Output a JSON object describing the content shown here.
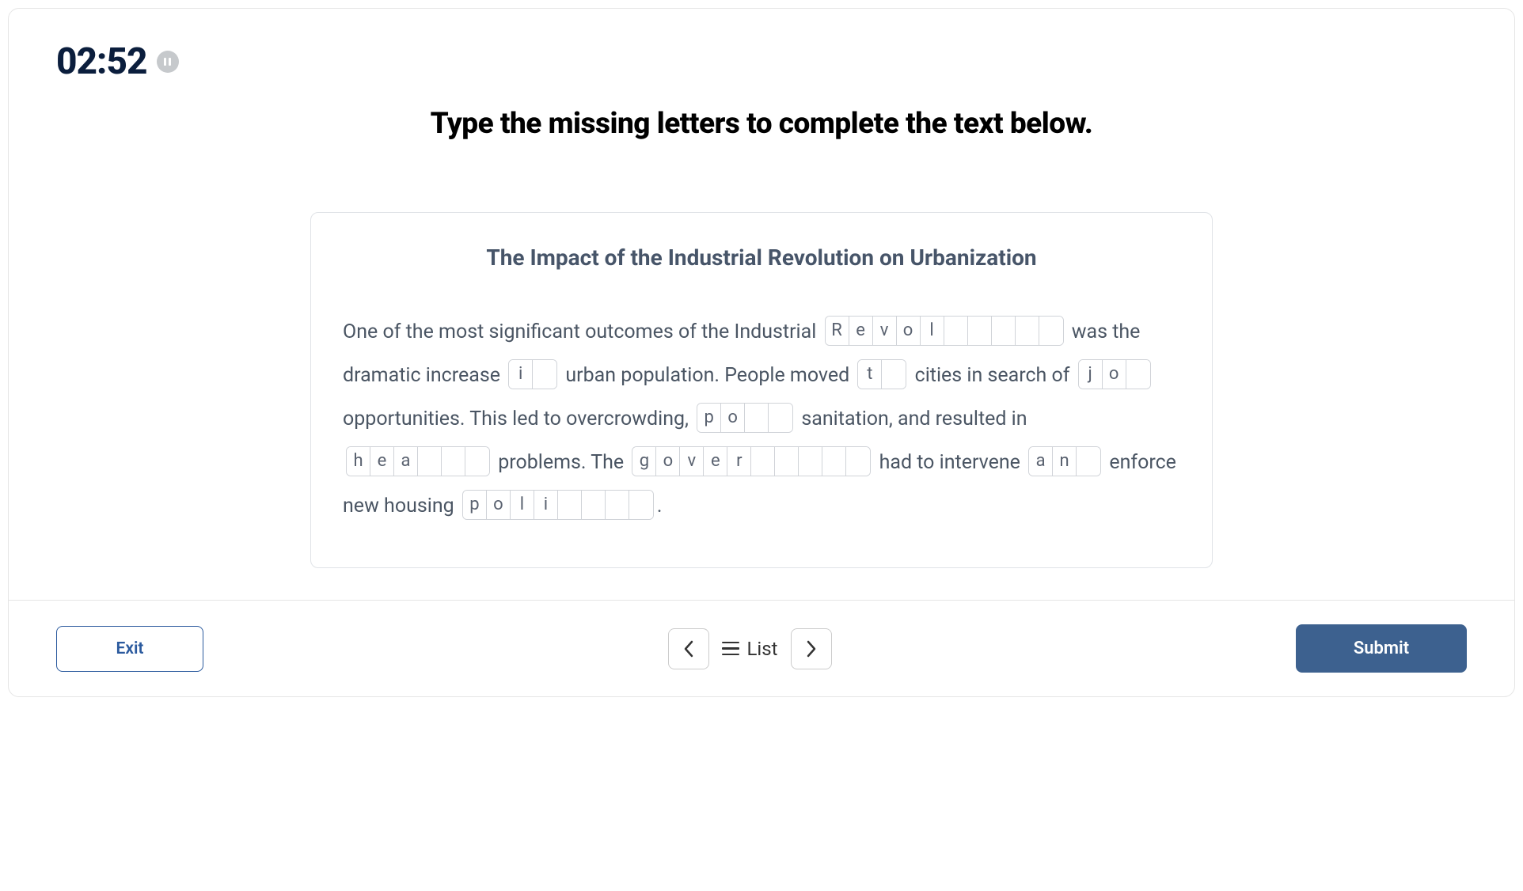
{
  "timer": "02:52",
  "instruction": "Type the missing letters to complete the text below.",
  "passage_title": "The Impact of the Industrial Revolution on Urbanization",
  "segments": [
    {
      "type": "text",
      "value": "One of the most significant outcomes of the Industrial "
    },
    {
      "type": "word",
      "letters": [
        "R",
        "e",
        "v",
        "o",
        "l",
        "",
        "",
        "",
        "",
        ""
      ]
    },
    {
      "type": "text",
      "value": " was the dramatic increase "
    },
    {
      "type": "word",
      "letters": [
        "i",
        ""
      ]
    },
    {
      "type": "text",
      "value": " urban population. People moved "
    },
    {
      "type": "word",
      "letters": [
        "t",
        ""
      ]
    },
    {
      "type": "text",
      "value": " cities in search of "
    },
    {
      "type": "word",
      "letters": [
        "j",
        "o",
        ""
      ]
    },
    {
      "type": "text",
      "value": " opportunities. This led to overcrowding, "
    },
    {
      "type": "word",
      "letters": [
        "p",
        "o",
        "",
        ""
      ]
    },
    {
      "type": "text",
      "value": " sanitation, and resulted in "
    },
    {
      "type": "word",
      "letters": [
        "h",
        "e",
        "a",
        "",
        "",
        ""
      ]
    },
    {
      "type": "text",
      "value": " problems. The "
    },
    {
      "type": "word",
      "letters": [
        "g",
        "o",
        "v",
        "e",
        "r",
        "",
        "",
        "",
        "",
        ""
      ]
    },
    {
      "type": "text",
      "value": " had to intervene "
    },
    {
      "type": "word",
      "letters": [
        "a",
        "n",
        ""
      ]
    },
    {
      "type": "text",
      "value": " enforce new housing "
    },
    {
      "type": "word",
      "letters": [
        "p",
        "o",
        "l",
        "i",
        "",
        "",
        "",
        ""
      ]
    },
    {
      "type": "text",
      "value": "."
    }
  ],
  "footer": {
    "exit": "Exit",
    "list": "List",
    "submit": "Submit"
  }
}
